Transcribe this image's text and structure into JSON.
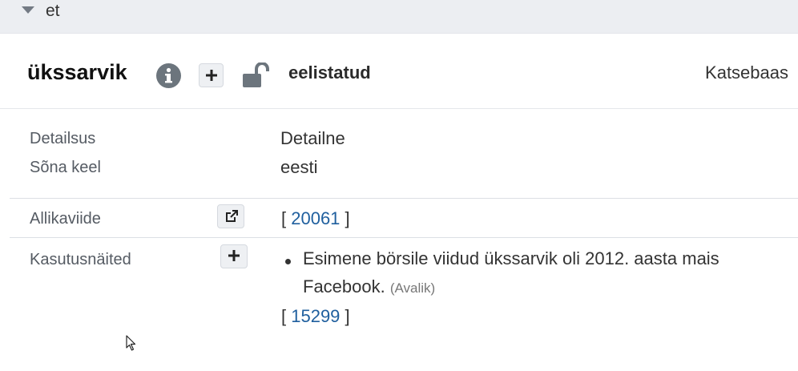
{
  "language": {
    "code": "et"
  },
  "word": {
    "title": "ükssarvik",
    "status": "eelistatud",
    "dataset": "Katsebaas"
  },
  "details": {
    "detail_label": "Detailsus",
    "detail_value": "Detailne",
    "lang_label": "Sõna keel",
    "lang_value": "eesti"
  },
  "source": {
    "label": "Allikaviide",
    "bracket_open": "[ ",
    "ref": "20061",
    "bracket_close": " ]"
  },
  "usage": {
    "label": "Kasutusnäited",
    "example_line1": "Esimene börsile viidud ükssarvik oli 2012. aasta mais",
    "example_line2": "Facebook.",
    "example_tag": "(Avalik)",
    "bracket_open": "[ ",
    "ref": "15299",
    "bracket_close": " ]"
  },
  "icons": {
    "collapse": "caret-down-icon",
    "info": "info-icon",
    "add": "plus-icon",
    "lock": "unlock-icon",
    "external": "external-link-icon",
    "cursor": "mouse-pointer-icon"
  },
  "colors": {
    "link": "#1f5f9e",
    "header_bg": "#eceef2",
    "icon_gray": "#6c757d"
  }
}
